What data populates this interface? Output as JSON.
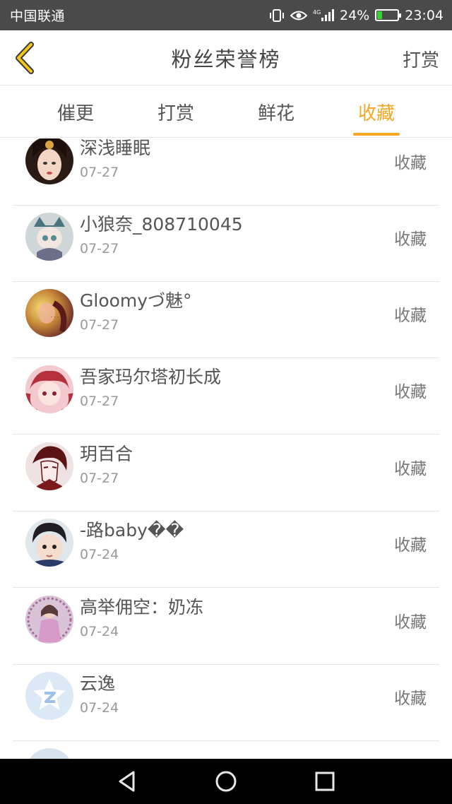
{
  "status_bar": {
    "carrier": "中国联通",
    "network": "4G",
    "battery": "24%",
    "battery_level": 0.24,
    "time": "23:04",
    "icons": [
      "vibrate-icon",
      "eye-icon",
      "signal-icon",
      "battery-icon"
    ]
  },
  "header": {
    "title": "粉丝荣誉榜",
    "back_icon": "chevron-left-icon",
    "reward_label": "打赏",
    "accent_color": "#f5a623"
  },
  "tabs": [
    {
      "label": "催更",
      "active": false
    },
    {
      "label": "打赏",
      "active": false
    },
    {
      "label": "鲜花",
      "active": false
    },
    {
      "label": "收藏",
      "active": true
    }
  ],
  "fans": [
    {
      "name": "深浅睡眠",
      "date": "07-27",
      "action": "收藏"
    },
    {
      "name": "小狼奈_808710045",
      "date": "07-27",
      "action": "收藏"
    },
    {
      "name": "Gloomyづ魅°",
      "date": "07-27",
      "action": "收藏"
    },
    {
      "name": "吾家玛尔塔初长成",
      "date": "07-27",
      "action": "收藏"
    },
    {
      "name": "玥百合",
      "date": "07-27",
      "action": "收藏"
    },
    {
      "name": "-路baby��",
      "date": "07-24",
      "action": "收藏"
    },
    {
      "name": "高举佣空：奶冻",
      "date": "07-24",
      "action": "收藏"
    },
    {
      "name": "云逸",
      "date": "07-24",
      "action": "收藏"
    }
  ],
  "nav_bar": {
    "icons": [
      "back-triangle-icon",
      "home-circle-icon",
      "recent-square-icon"
    ]
  }
}
